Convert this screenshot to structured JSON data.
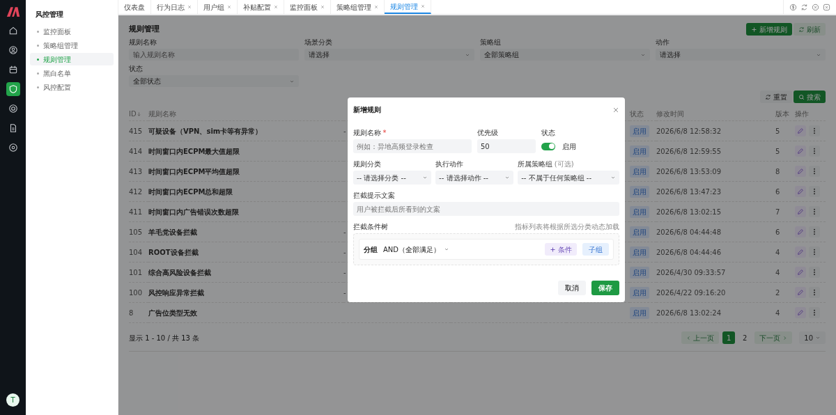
{
  "rail": {
    "items": [
      {
        "kind": "home",
        "selected": false
      },
      {
        "kind": "user",
        "selected": false
      },
      {
        "kind": "calendar",
        "selected": false
      },
      {
        "kind": "shield",
        "selected": true
      },
      {
        "kind": "aperture",
        "selected": false
      },
      {
        "kind": "document",
        "selected": false
      },
      {
        "kind": "gear",
        "selected": false
      }
    ],
    "avatar": "T"
  },
  "sidebar": {
    "title": "风控管理",
    "items": [
      {
        "label": "监控面板",
        "selected": false
      },
      {
        "label": "策略组管理",
        "selected": false
      },
      {
        "label": "规则管理",
        "selected": true
      },
      {
        "label": "黑白名单",
        "selected": false
      },
      {
        "label": "风控配置",
        "selected": false
      }
    ]
  },
  "tabs": [
    {
      "label": "仪表盘",
      "closable": false,
      "selected": false
    },
    {
      "label": "行为日志",
      "closable": true,
      "selected": false
    },
    {
      "label": "用户组",
      "closable": true,
      "selected": false
    },
    {
      "label": "补贴配置",
      "closable": true,
      "selected": false
    },
    {
      "label": "监控面板",
      "closable": true,
      "selected": false
    },
    {
      "label": "策略组管理",
      "closable": true,
      "selected": false
    },
    {
      "label": "规则管理",
      "closable": true,
      "selected": true
    }
  ],
  "page": {
    "title": "规则管理",
    "add_button": "新增规则",
    "refresh_button": "刷新",
    "filters": [
      {
        "label": "规则名称",
        "kind": "input",
        "placeholder": "输入规则名称"
      },
      {
        "label": "场景分类",
        "kind": "select",
        "value": "请选择"
      },
      {
        "label": "策略组",
        "kind": "select",
        "value": "全部策略组"
      },
      {
        "label": "动作",
        "kind": "select",
        "value": "请选择"
      },
      {
        "label": "状态",
        "kind": "select",
        "value": "全部状态"
      }
    ],
    "reset_button": "重置",
    "search_button": "搜索"
  },
  "table": {
    "columns": [
      "ID",
      "规则名称",
      "状态",
      "修改时间",
      "版本",
      "操作"
    ],
    "rows": [
      {
        "id": "415",
        "name": "可疑设备（VPN、sim卡等有异常）",
        "group": "-",
        "status": "启用",
        "modified": "2026/6/8 12:58:32",
        "version": "5"
      },
      {
        "id": "414",
        "name": "时间窗口内ECPM最大值超限",
        "status": "启用",
        "modified": "2026/6/8 12:59:55",
        "version": "5"
      },
      {
        "id": "413",
        "name": "时间窗口内ECPM平均值超限",
        "status": "启用",
        "modified": "2026/6/8 13:53:09",
        "version": "8"
      },
      {
        "id": "412",
        "name": "时间窗口内ECPM总和超限",
        "status": "启用",
        "modified": "2026/6/8 13:47:23",
        "version": "6"
      },
      {
        "id": "411",
        "name": "时间窗口内广告错误次数超限",
        "status": "启用",
        "modified": "2026/6/8 13:02:15",
        "version": "7"
      },
      {
        "id": "105",
        "name": "羊毛党设备拦截",
        "group": "-",
        "status": "启用",
        "modified": "2026/6/8 04:44:48",
        "version": "6"
      },
      {
        "id": "104",
        "name": "ROOT设备拦截",
        "group": "-",
        "status": "启用",
        "modified": "2026/6/8 04:44:46",
        "version": "4"
      },
      {
        "id": "101",
        "name": "综合高风险设备拦截",
        "group": "-",
        "status": "启用",
        "modified": "2026/4/30 09:33:57",
        "version": "4"
      },
      {
        "id": "100",
        "name": "风控响应异常拦截",
        "group": "-",
        "status": "启用",
        "modified": "2026/4/22 09:16:20",
        "version": "2"
      },
      {
        "id": "8",
        "name": "广告位类型无效",
        "status": "启用",
        "modified": "2026/6/8 13:02:24",
        "version": "4"
      }
    ]
  },
  "footer": {
    "summary": "显示 1 - 10 / 共 13 条",
    "prev": "上一页",
    "pages": [
      {
        "label": "1",
        "selected": true
      },
      {
        "label": "2",
        "selected": false
      }
    ],
    "next": "下一页",
    "page_size": "10"
  },
  "modal": {
    "title": "新增规则",
    "name": {
      "label": "规则名称",
      "required_mark": "*",
      "placeholder": "例如：异地高频登录检查"
    },
    "priority": {
      "label": "优先级",
      "value": "50"
    },
    "status": {
      "label": "状态",
      "on": true,
      "text": "启用"
    },
    "selects": [
      {
        "label": "规则分类",
        "value": "-- 请选择分类 --"
      },
      {
        "label": "执行动作",
        "value": "-- 请选择动作 --"
      },
      {
        "label": "所属策略组",
        "note": "(可选)",
        "value": "-- 不属于任何策略组 --"
      }
    ],
    "message": {
      "label": "拦截提示文案",
      "placeholder": "用户被拦截后所看到的文案"
    },
    "tree": {
      "label": "拦截条件树",
      "hint": "指标列表将根据所选分类动态加载",
      "group_label": "分组",
      "logic": "AND（全部满足）",
      "add_condition": "条件",
      "add_subgroup": "子组"
    },
    "cancel": "取消",
    "save": "保存"
  }
}
